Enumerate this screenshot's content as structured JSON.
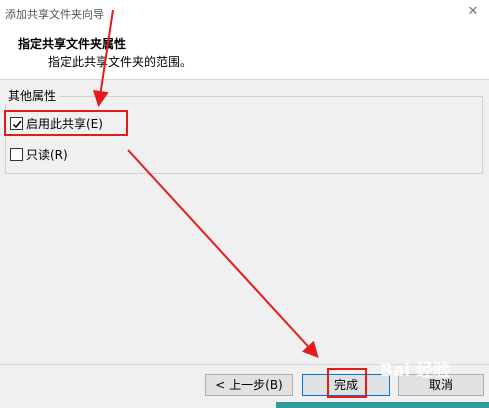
{
  "window": {
    "title": "添加共享文件夹向导",
    "close_glyph": "✕"
  },
  "header": {
    "title": "指定共享文件夹属性",
    "subtitle": "指定此共享文件夹的范围。"
  },
  "group": {
    "legend": "其他属性",
    "options": [
      {
        "label": "启用此共享(E)",
        "checked": true
      },
      {
        "label": "只读(R)",
        "checked": false
      }
    ]
  },
  "buttons": {
    "back": "< 上一步(B)",
    "finish": "完成",
    "cancel": "取消"
  },
  "watermark": "Bai 经验",
  "colors": {
    "annotation": "#e51b1b",
    "accent": "#2e9c9c"
  }
}
